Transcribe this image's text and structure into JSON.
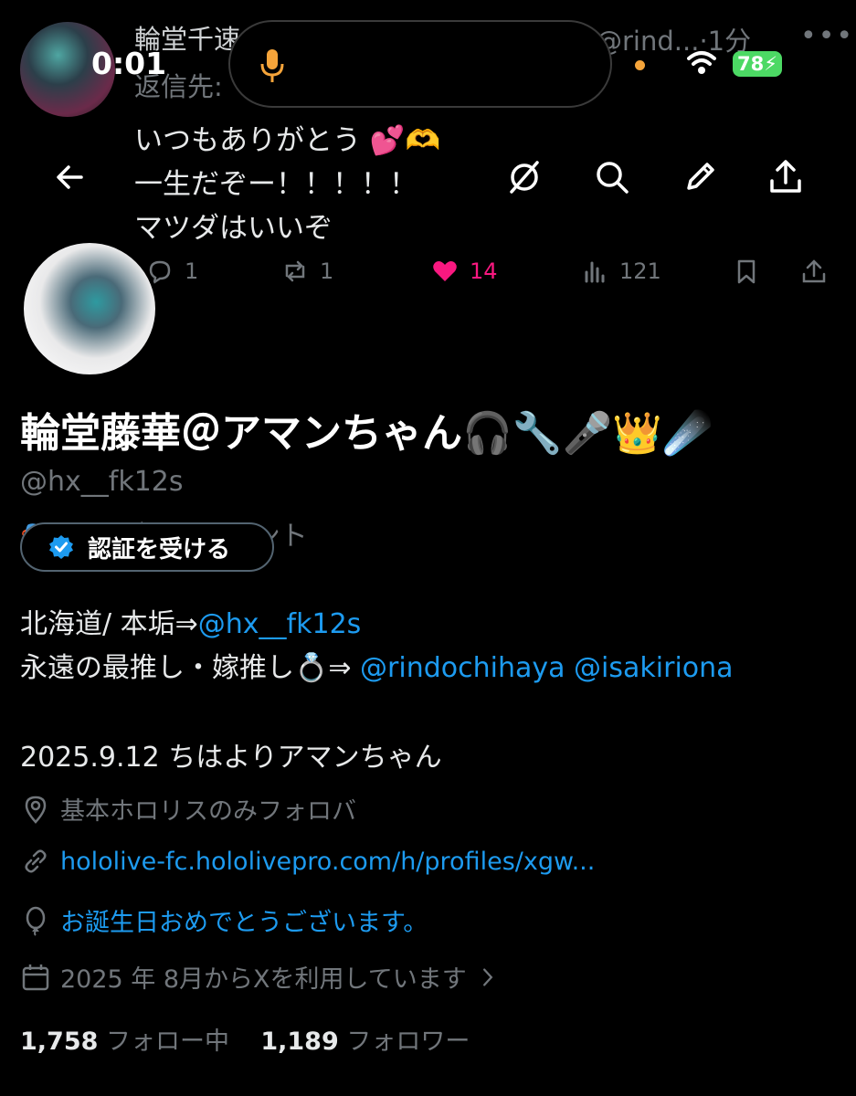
{
  "status_bar": {
    "time": "0:01",
    "battery": "78"
  },
  "background_tweet": {
    "name": "輪堂千速",
    "handle": "@rind...",
    "time": "·1分",
    "reply_prefix": "返信先:",
    "lines": [
      "いつもありがとう 💕🫶",
      "一生だぞー！！！！！",
      "マツダはいいぞ"
    ],
    "actions": {
      "replies": "1",
      "reposts": "1",
      "likes": "14",
      "views": "121"
    }
  },
  "profile": {
    "display_name": "輪堂藤華＠アマンちゃん🎧🔧🎤👑☄️",
    "handle": "@hx__fk12s",
    "parody_label": "パロディアカウント",
    "verify_button": "認証を受ける",
    "bio": {
      "line1_prefix": "北海道/ 本垢⇒",
      "line1_link": "@hx__fk12s",
      "line2_prefix": "永遠の最推し・嫁推し💍⇒ ",
      "line2_link1": "@rindochihaya",
      "line2_link2": "@isakiriona",
      "line3": "2025.9.12 ちはよりアマンちゃん"
    },
    "location": "基本ホロリスのみフォロバ",
    "website": "hololive-fc.hololivepro.com/h/profiles/xgw...",
    "birthday": "お誕生日おめでとうございます。",
    "joined": "2025 年 8月からXを利用しています",
    "following_count": "1,758",
    "following_label": "フォロー中",
    "followers_count": "1,189",
    "followers_label": "フォロワー"
  },
  "icons": [
    "back-arrow-icon",
    "grok-icon",
    "search-icon",
    "edit-icon",
    "share-icon",
    "location-icon",
    "link-icon",
    "balloon-icon",
    "calendar-icon",
    "verified-badge-icon"
  ],
  "colors": {
    "background": "#000000",
    "link": "#1d9bf0",
    "like": "#f91880",
    "muted": "#71767b"
  }
}
